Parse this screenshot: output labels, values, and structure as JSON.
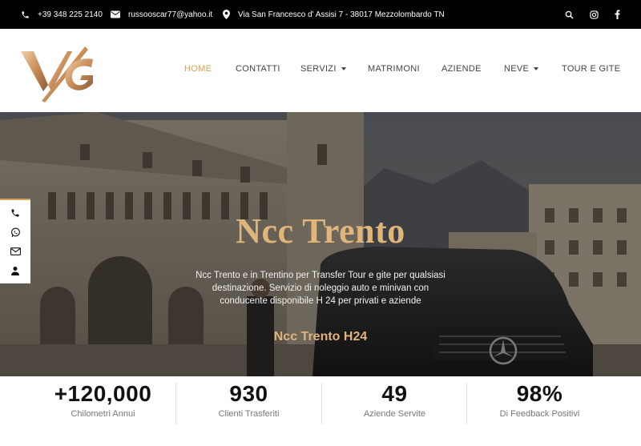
{
  "topbar": {
    "phone": "+39 348 225 2140",
    "email": "russooscar77@yahoo.it",
    "address": "Via San Francesco d' Assisi 7 - 38017 Mezzolombardo TN",
    "icons": [
      "phone-icon",
      "envelope-icon",
      "map-pin-icon",
      "search-icon",
      "instagram-icon",
      "facebook-icon"
    ]
  },
  "nav": {
    "items": [
      {
        "label": "HOME",
        "active": true
      },
      {
        "label": "CONTATTI"
      },
      {
        "label": "SERVIZI",
        "dropdown": true
      },
      {
        "label": "MATRIMONI"
      },
      {
        "label": "AZIENDE"
      },
      {
        "label": "NEVE",
        "dropdown": true
      },
      {
        "label": "TOUR E GITE"
      }
    ]
  },
  "hero": {
    "title": "Ncc Trento",
    "description": "Ncc Trento e in Trentino per Transfer Tour e gite per qualsiasi destinazione. Servizio di noleggio auto e minivan  con conducente disponibile H 24 per privati e aziende",
    "subtitle": "Ncc Trento H24"
  },
  "side_contacts": [
    "phone-icon",
    "whatsapp-icon",
    "envelope-icon",
    "user-icon"
  ],
  "stats": [
    {
      "number": "+120,000",
      "label": "Chilometri Annui"
    },
    {
      "number": "930",
      "label": "Clienti Trasferiti"
    },
    {
      "number": "49",
      "label": "Aziende Servite"
    },
    {
      "number": "98%",
      "label": "Di Feedback Positivi"
    }
  ],
  "colors": {
    "accent": "#d4a25a",
    "topbar": "#000000",
    "hero_title": "#e0b57a"
  }
}
